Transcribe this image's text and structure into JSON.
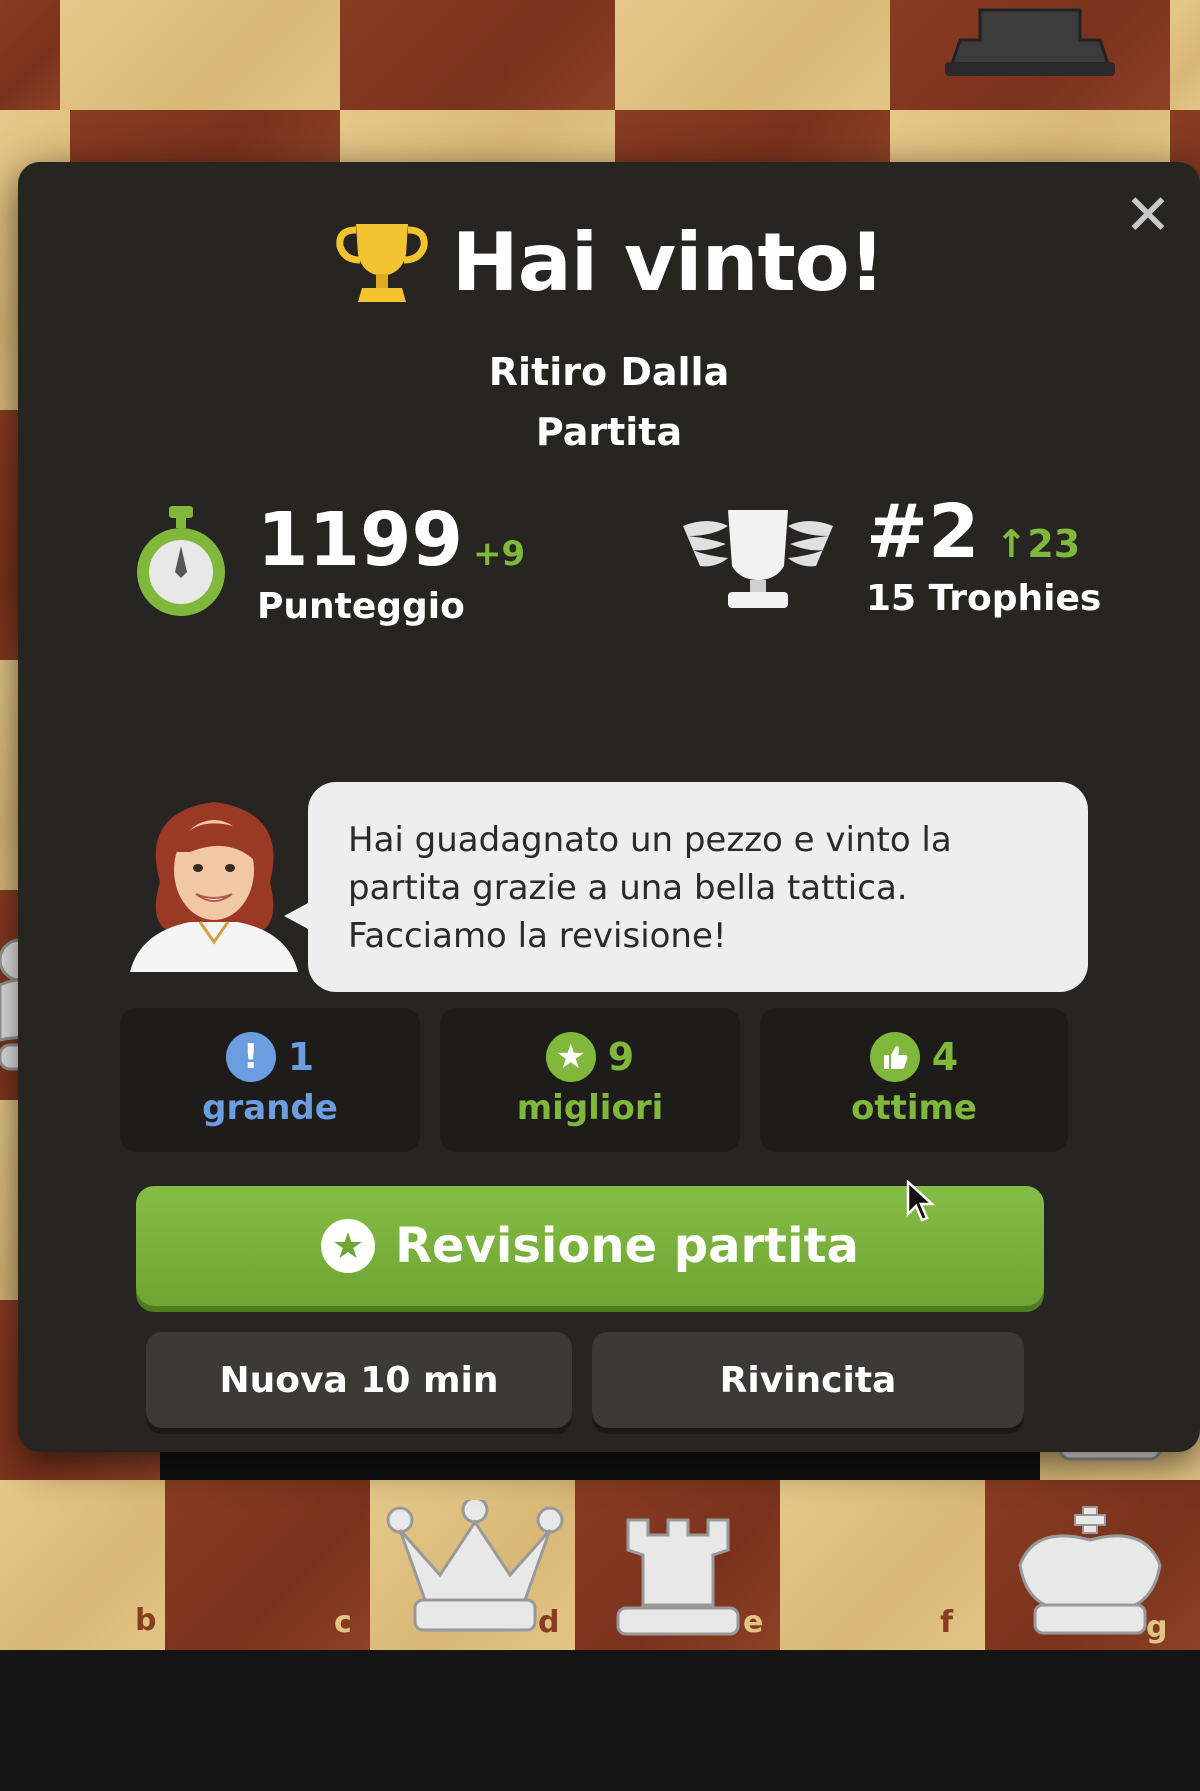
{
  "board": {
    "files": [
      "b",
      "c",
      "d",
      "e",
      "f",
      "g"
    ]
  },
  "modal": {
    "close_icon": "close-icon",
    "title": "Hai vinto!",
    "subtitle_line1": "Ritiro Dalla",
    "subtitle_line2": "Partita",
    "rating": {
      "value": "1199",
      "delta": "+9",
      "label": "Punteggio",
      "icon": "stopwatch-icon"
    },
    "rank": {
      "value": "#2",
      "change": "23",
      "label": "15 Trophies",
      "icon": "winged-trophy-icon"
    },
    "coach_message": "Hai guadagnato un pezzo e vinto la partita grazie a una bella tattica. Facciamo la revisione!",
    "move_stats": [
      {
        "count": "1",
        "label": "grande",
        "icon": "exclamation-icon",
        "color": "#6a9ee0"
      },
      {
        "count": "9",
        "label": "migliori",
        "icon": "star-icon",
        "color": "#7fb83b"
      },
      {
        "count": "4",
        "label": "ottime",
        "icon": "thumbs-up-icon",
        "color": "#7fb83b"
      }
    ],
    "review_button": "Revisione partita",
    "new_game_button": "Nuova 10 min",
    "rematch_button": "Rivincita"
  },
  "colors": {
    "accent_green": "#7fb83b",
    "modal_bg": "#262522",
    "great_blue": "#6a9ee0"
  }
}
